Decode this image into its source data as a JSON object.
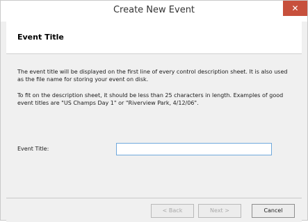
{
  "window": {
    "title": "Create New Event",
    "close_label": "✕"
  },
  "header": {
    "title": "Event Title"
  },
  "content": {
    "para1": "The event title will be displayed on the first line of every control description sheet. It is also used as the file name for storing your event on disk.",
    "para2": "To fit on the description sheet, it should be less than 25 characters in length. Examples of good event titles are \"US Champs Day 1\" or \"Riverview Park, 4/12/06\".",
    "field_label": "Event Title:",
    "field_value": ""
  },
  "footer": {
    "back_label": "< Back",
    "next_label": "Next >",
    "cancel_label": "Cancel"
  }
}
